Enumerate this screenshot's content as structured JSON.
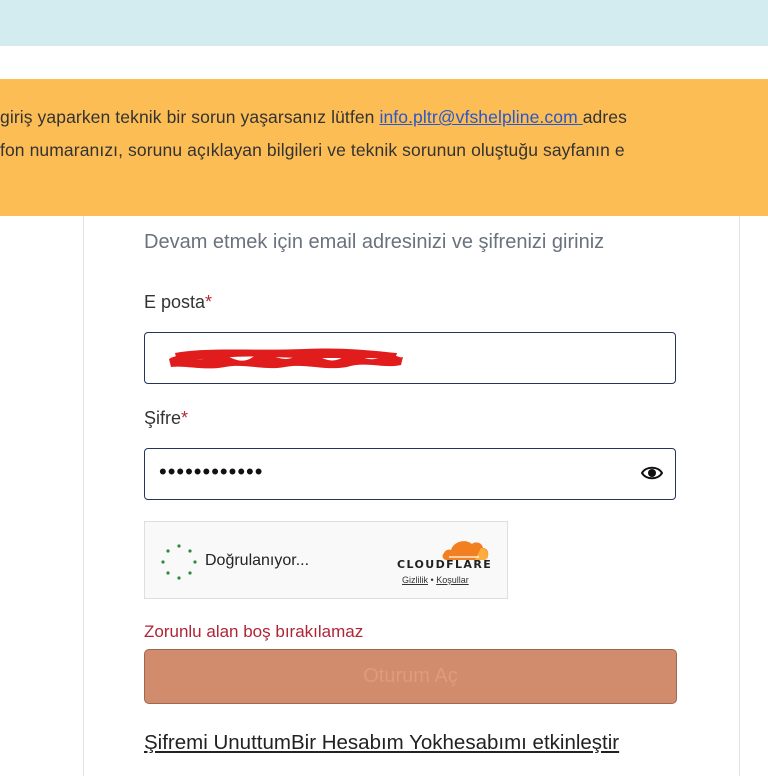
{
  "notice": {
    "line1_before": "giriş yaparken teknik bir sorun yaşarsanız lütfen ",
    "line1_link": "info.pltr@vfshelpline.com ",
    "line1_after": "adres",
    "line2": "fon numaranızı, sorunu açıklayan bilgileri ve teknik sorunun oluştuğu sayfanın e"
  },
  "form": {
    "subtitle": "Devam etmek için email adresinizi ve şifrenizi giriniz",
    "email_label": "E posta",
    "password_label": "Şifre",
    "required_mark": "*",
    "password_value": "••••••••••••",
    "error_text": "Zorunlu alan boş bırakılamaz",
    "submit_label": "Oturum Aç"
  },
  "captcha": {
    "status": "Doğrulanıyor...",
    "brand": "CLOUDFLARE",
    "privacy": "Gizlilik",
    "separator": "•",
    "terms": "Koşullar"
  },
  "links": {
    "forgot": "Şifremi Unuttum",
    "no_account": "Bir Hesabım Yok",
    "activate": "hesabımı etkinleştir"
  },
  "colors": {
    "notice_bg": "#fdbd55",
    "top_band": "#d3ecef",
    "submit_bg": "#d18b6d",
    "error": "#b02437",
    "input_border": "#24345c"
  }
}
